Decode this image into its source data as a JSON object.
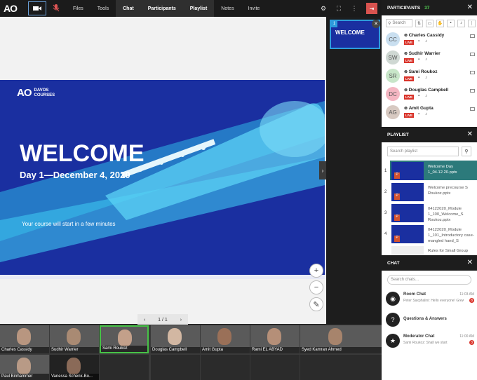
{
  "toolbar": {
    "logo": "AO",
    "nav": [
      "Files",
      "Tools",
      "Chat",
      "Participants",
      "Playlist",
      "Notes",
      "Invite"
    ],
    "active_nav": [
      "Chat",
      "Participants",
      "Playlist"
    ]
  },
  "slide": {
    "logo_text": "AO",
    "logo_sub1": "DAVOS",
    "logo_sub2": "COURSES",
    "heading": "WELCOME",
    "date_line": "Day 1—December 4, 2020",
    "start_note": "Your course will start in a few minutes"
  },
  "thumbnail": {
    "number": "1",
    "title": "WELCOME"
  },
  "pager": {
    "label": "1 / 1"
  },
  "video_tiles": [
    "Charles Cassidy",
    "Sudhir Warrier",
    "Sami Roukoz",
    "Douglas Campbell",
    "Amit Gupta",
    "Rami EL ABYAD",
    "Syed Kamran Ahmed",
    "Paul Binhammer",
    "Vanessa Schenk-Bo..."
  ],
  "participants": {
    "header": "PARTICIPANTS",
    "count": "37",
    "search_placeholder": "Search",
    "people": [
      {
        "initials": "CC",
        "name": "Charles Cassidy",
        "color": "#c9dff0"
      },
      {
        "initials": "SW",
        "name": "Sudhir Warrier",
        "color": "#cfd8d3"
      },
      {
        "initials": "SR",
        "name": "Sami Roukoz",
        "color": "#c8e6c9"
      },
      {
        "initials": "DC",
        "name": "Douglas Campbell",
        "color": "#f4b6c2"
      },
      {
        "initials": "AG",
        "name": "Amit Gupta",
        "color": "#d7c9c1"
      }
    ],
    "live_label": "LIVE"
  },
  "playlist": {
    "header": "PLAYLIST",
    "search_placeholder": "Search playlist",
    "items": [
      {
        "num": "1",
        "title": "Welcome Day 1_04.12.20.pptx"
      },
      {
        "num": "2",
        "title": "Welcome precourse S Roukoz.pptx"
      },
      {
        "num": "3",
        "title": "04122020_Module 1_100_Welcome_S Roukoz.pptx"
      },
      {
        "num": "4",
        "title": "04122020_Module 1_101_Introductory case-mangled hand_S"
      },
      {
        "num": "",
        "title": "Rules for Small Group"
      }
    ]
  },
  "chat": {
    "header": "CHAT",
    "search_placeholder": "Search chats...",
    "rooms": [
      {
        "icon": "◉",
        "title": "Room Chat",
        "msg": "Peter Saxphalini: Hello everyone! Grew...",
        "time": "11:03 AM",
        "badge": "8"
      },
      {
        "icon": "?",
        "title": "Questions & Answers",
        "msg": "",
        "time": "",
        "badge": ""
      },
      {
        "icon": "★",
        "title": "Moderator Chat",
        "msg": "Sami Roukoz: Shall we start",
        "time": "11:00 AM",
        "badge": "3"
      }
    ]
  },
  "colors": {
    "slide_bg": "#1a2fa0",
    "accent_green": "#46c246",
    "live_red": "#d9342b",
    "playlist_active": "#2c7a7b"
  }
}
